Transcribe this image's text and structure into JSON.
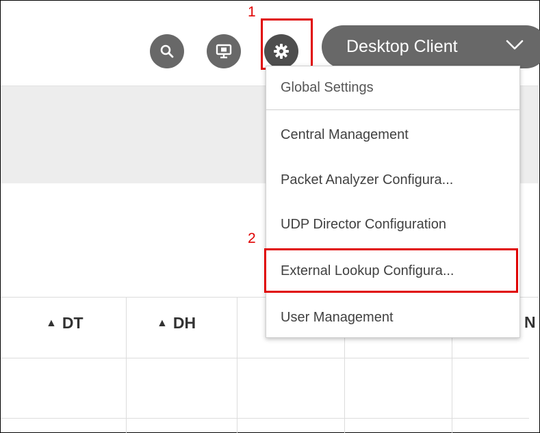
{
  "header": {
    "client_label": "Desktop Client",
    "icons": [
      "search-icon",
      "monitor-icon",
      "gear-icon",
      "chevron-down-icon"
    ]
  },
  "annotations": {
    "step1": "1",
    "step2": "2"
  },
  "menu": {
    "items": [
      {
        "label": "Global Settings"
      },
      {
        "label": "Central Management"
      },
      {
        "label": "Packet Analyzer Configura..."
      },
      {
        "label": "UDP Director Configuration"
      },
      {
        "label": "External Lookup Configura..."
      },
      {
        "label": "User Management"
      }
    ]
  },
  "table": {
    "columns": [
      {
        "label": "DT"
      },
      {
        "label": "DH"
      }
    ],
    "cut_column": "N"
  },
  "colors": {
    "highlight": "#e00000",
    "button_bg": "#686868",
    "band_grey": "#ededed"
  }
}
